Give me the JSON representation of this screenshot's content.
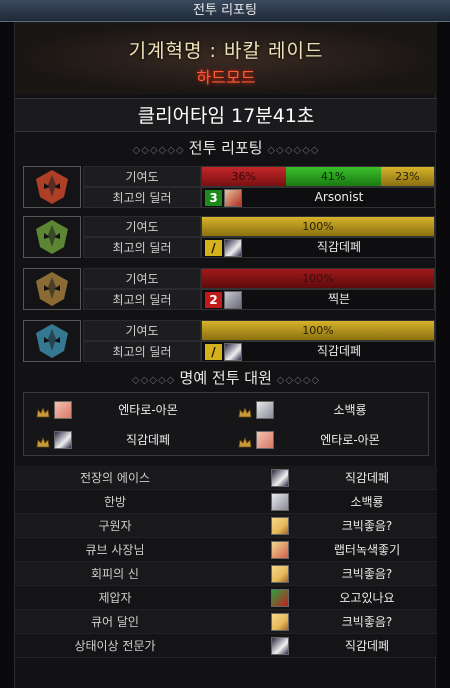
{
  "window": {
    "title": "전투 리포팅"
  },
  "raid": {
    "name": "기계혁명 : 바칼 레이드",
    "mode": "하드모드"
  },
  "clear_time": "클리어타임  17분41초",
  "sections": {
    "battle_report": "전투 리포팅",
    "honor": "명예 전투 대원"
  },
  "bosses": [
    {
      "contribution_label": "기여도",
      "dealer_label": "최고의 딜러",
      "segments": [
        {
          "text": "36%",
          "value": 36,
          "color": "red"
        },
        {
          "text": "41%",
          "value": 41,
          "color": "green"
        },
        {
          "text": "23%",
          "value": 23,
          "color": "yellow"
        }
      ],
      "dealer_icon_text": "3",
      "dealer_icon_color": "green",
      "dealer_avatar": "av-redhair",
      "dealer_name": "Arsonist",
      "portrait_color": "#c8462a"
    },
    {
      "contribution_label": "기여도",
      "dealer_label": "최고의 딜러",
      "segments": [
        {
          "text": "100%",
          "value": 100,
          "color": "yellow"
        }
      ],
      "dealer_icon_text": "/",
      "dealer_icon_color": "yellow",
      "dealer_avatar": "av-dark",
      "dealer_name": "직감데페",
      "portrait_color": "#6a9a3a"
    },
    {
      "contribution_label": "기여도",
      "dealer_label": "최고의 딜러",
      "segments": [
        {
          "text": "100%",
          "value": 100,
          "color": "redfull"
        }
      ],
      "dealer_icon_text": "2",
      "dealer_icon_color": "red",
      "dealer_avatar": "av-silver",
      "dealer_name": "찍븐",
      "portrait_color": "#a07a3a"
    },
    {
      "contribution_label": "기여도",
      "dealer_label": "최고의 딜러",
      "segments": [
        {
          "text": "100%",
          "value": 100,
          "color": "yellow"
        }
      ],
      "dealer_icon_text": "/",
      "dealer_icon_color": "yellow",
      "dealer_avatar": "av-dark",
      "dealer_name": "직감데페",
      "portrait_color": "#3a8aa8"
    }
  ],
  "honor_members": [
    {
      "name": "엔타로-아몬",
      "avatar": "av-pink"
    },
    {
      "name": "소백룡",
      "avatar": "av-white"
    },
    {
      "name": "직감데페",
      "avatar": "av-dark"
    },
    {
      "name": "엔타로-아몬",
      "avatar": "av-pink"
    }
  ],
  "titles": [
    {
      "label": "전장의 에이스",
      "player": "직감데페",
      "avatar": "av-dark"
    },
    {
      "label": "한방",
      "player": "소백룡",
      "avatar": "av-white"
    },
    {
      "label": "구원자",
      "player": "크빅좋음?",
      "avatar": "av-blond"
    },
    {
      "label": "큐브 사장님",
      "player": "랩터녹색좋기",
      "avatar": "av-mix"
    },
    {
      "label": "회피의 신",
      "player": "크빅좋음?",
      "avatar": "av-blond"
    },
    {
      "label": "제압자",
      "player": "오고있나요",
      "avatar": "av-green"
    },
    {
      "label": "큐어 달인",
      "player": "크빅좋음?",
      "avatar": "av-blond"
    },
    {
      "label": "상태이상 전문가",
      "player": "직감데페",
      "avatar": "av-dark"
    }
  ]
}
